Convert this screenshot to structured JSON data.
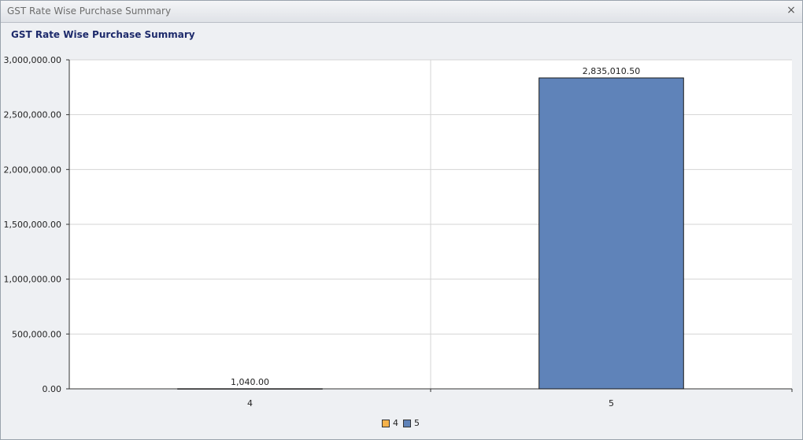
{
  "window": {
    "title": "GST Rate Wise Purchase Summary",
    "close_glyph": "×"
  },
  "header": {
    "title": "GST Rate Wise Purchase Summary"
  },
  "colors": {
    "series_4": "#f5b24a",
    "series_5": "#5f83b9"
  },
  "chart_data": {
    "type": "bar",
    "title": "",
    "xlabel": "",
    "ylabel": "",
    "categories": [
      "4",
      "5"
    ],
    "values": [
      1040.0,
      2835010.5
    ],
    "data_labels": [
      "1,040.00",
      "2,835,010.50"
    ],
    "ylim": [
      0,
      3000000
    ],
    "yticks": [
      0,
      500000,
      1000000,
      1500000,
      2000000,
      2500000,
      3000000
    ],
    "ytick_labels": [
      "0.00",
      "500,000.00",
      "1,000,000.00",
      "1,500,000.00",
      "2,000,000.00",
      "2,500,000.00",
      "3,000,000.00"
    ],
    "grid": true,
    "legend": {
      "placement": "bottom",
      "entries": [
        {
          "label": "4",
          "color": "#f5b24a"
        },
        {
          "label": "5",
          "color": "#5f83b9"
        }
      ]
    }
  }
}
